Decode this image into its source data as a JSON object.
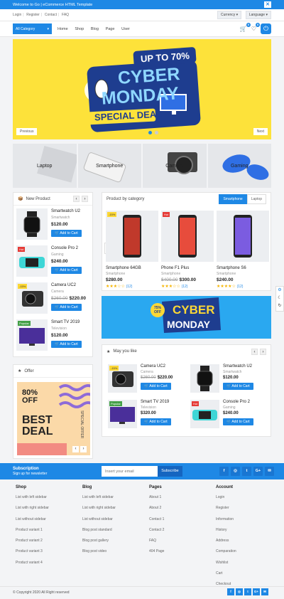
{
  "topbar": {
    "welcome": "Welcome to Go | eCommerce HTML Template"
  },
  "header_links": [
    "Login",
    "Register",
    "Contact",
    "FAQ"
  ],
  "currency": "Currency",
  "language": "Language",
  "nav": {
    "all_category": "All Category",
    "menu": [
      "Home",
      "Shop",
      "Blog",
      "Page",
      "User"
    ],
    "cart_count": "0",
    "wish_count": "0"
  },
  "hero": {
    "up_to": "UP TO 70%",
    "line1": "CYBER",
    "line2": "MONDAY",
    "line3": "SPECIAL DEAL",
    "prev": "Previous",
    "next": "Next"
  },
  "categories": [
    "Laptop",
    "Smartphone",
    "Camera",
    "Gaming"
  ],
  "new_product": {
    "title": "New Product",
    "items": [
      {
        "name": "Smartwatch U2",
        "cat": "Smartwatch",
        "price": "$120.00",
        "old": "",
        "badge": ""
      },
      {
        "name": "Console Pro 2",
        "cat": "Gaming",
        "price": "$240.00",
        "old": "",
        "badge": "Hot"
      },
      {
        "name": "Camera UC2",
        "cat": "Camera",
        "price": "$220.00",
        "old": "$260.00",
        "badge": "-15%"
      },
      {
        "name": "Smart TV 2019",
        "cat": "Television",
        "price": "$120.00",
        "old": "",
        "badge": "Popular"
      }
    ]
  },
  "add_to_cart": "Add to Cart",
  "by_category": {
    "title": "Product by category",
    "tabs": [
      "Smartphone",
      "Laptop"
    ],
    "items": [
      {
        "name": "Smartphone 64GB",
        "cat": "Smartphone",
        "price": "$280.00",
        "old": "",
        "reviews": "(12)",
        "badge": "-15%"
      },
      {
        "name": "Phone F1 Plus",
        "cat": "Smartphone",
        "price": "$300.00",
        "old": "$400.00",
        "reviews": "(12)",
        "badge": "Hot"
      },
      {
        "name": "Smartphone S6",
        "cat": "Smartphone",
        "price": "$240.00",
        "old": "",
        "reviews": "(12)",
        "badge": ""
      }
    ]
  },
  "promo": {
    "pct": "75%",
    "off": "OFF",
    "line1": "CYBER",
    "line2": "MONDAY"
  },
  "offer": {
    "title": "Offer",
    "pct": "80%",
    "off": "OFF",
    "best": "BEST",
    "deal": "DEAL",
    "special": "SPECIAL OFFER"
  },
  "may_like": {
    "title": "May you like",
    "items": [
      {
        "name": "Camera UC2",
        "cat": "Camera",
        "price": "$220.00",
        "old": "$260.00",
        "badge": "-15%"
      },
      {
        "name": "Smartwatch U2",
        "cat": "Smartwatch",
        "price": "$120.00",
        "old": "",
        "badge": ""
      },
      {
        "name": "Smart TV 2019",
        "cat": "Television",
        "price": "$320.00",
        "old": "",
        "badge": "Popular"
      },
      {
        "name": "Console Pro 2",
        "cat": "Gaming",
        "price": "$240.00",
        "old": "",
        "badge": "Hot"
      }
    ]
  },
  "subscribe": {
    "title": "Subscription",
    "subtitle": "Sign up for newsletter",
    "placeholder": "Insert your email",
    "button": "Subscribe"
  },
  "footer": {
    "columns": [
      {
        "title": "Shop",
        "links": [
          "List with left sidebar",
          "List with right sidebar",
          "List without sidebar",
          "Product variant 1",
          "Product variant 2",
          "Product variant 3",
          "Product variant 4"
        ]
      },
      {
        "title": "Blog",
        "links": [
          "List with left sidebar",
          "List with right sidebar",
          "List without sidebar",
          "Blog post standard",
          "Blog post gallery",
          "Blog post video"
        ]
      },
      {
        "title": "Pages",
        "links": [
          "About 1",
          "About 2",
          "Contact 1",
          "Contact 2",
          "FAQ",
          "404 Page"
        ]
      },
      {
        "title": "Account",
        "links": [
          "Login",
          "Register",
          "Information",
          "History",
          "Address",
          "Comparation",
          "Wishlist",
          "Cart",
          "Checkout"
        ]
      }
    ],
    "copyright": "© Copyright 2020 All Right reserved"
  },
  "colors": {
    "primary": "#1e88e5",
    "hero_bg": "#fde23a"
  }
}
